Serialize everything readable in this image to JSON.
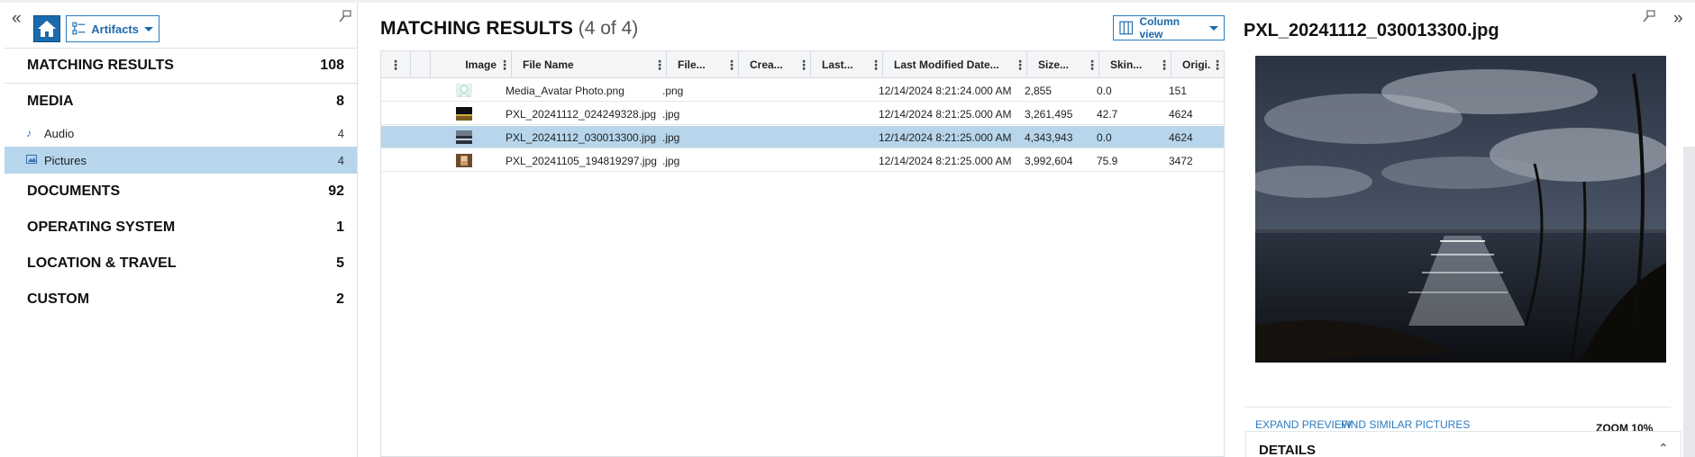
{
  "toolbar": {
    "artifacts_label": "Artifacts"
  },
  "categories": {
    "matching_results": {
      "label": "MATCHING RESULTS",
      "count": "108"
    },
    "media": {
      "label": "MEDIA",
      "count": "8"
    },
    "media_items": [
      {
        "label": "Audio",
        "count": "4",
        "icon": "music-note-icon"
      },
      {
        "label": "Pictures",
        "count": "4",
        "icon": "picture-icon",
        "selected": true
      }
    ],
    "documents": {
      "label": "DOCUMENTS",
      "count": "92"
    },
    "operating_system": {
      "label": "OPERATING SYSTEM",
      "count": "1"
    },
    "location_travel": {
      "label": "LOCATION & TRAVEL",
      "count": "5"
    },
    "custom": {
      "label": "CUSTOM",
      "count": "2"
    }
  },
  "main": {
    "title": "MATCHING RESULTS",
    "count": "(4 of 4)",
    "column_view_label": "Column view",
    "columns": [
      "Image",
      "File Name",
      "File...",
      "Crea...",
      "Last...",
      "Last Modified Date...",
      "Size...",
      "Skin...",
      "Origi..."
    ],
    "rows": [
      {
        "file_name": "Media_Avatar Photo.png",
        "ext": ".png",
        "created": "",
        "last": "",
        "modified": "12/14/2024 8:21:24.000 AM",
        "size": "2,855",
        "skin": "0.0",
        "orig": "151",
        "selected": false
      },
      {
        "file_name": "PXL_20241112_024249328.jpg",
        "ext": ".jpg",
        "created": "",
        "last": "",
        "modified": "12/14/2024 8:21:25.000 AM",
        "size": "3,261,495",
        "skin": "42.7",
        "orig": "4624",
        "selected": false
      },
      {
        "file_name": "PXL_20241112_030013300.jpg",
        "ext": ".jpg",
        "created": "",
        "last": "",
        "modified": "12/14/2024 8:21:25.000 AM",
        "size": "4,343,943",
        "skin": "0.0",
        "orig": "4624",
        "selected": true
      },
      {
        "file_name": "PXL_20241105_194819297.jpg",
        "ext": ".jpg",
        "created": "",
        "last": "",
        "modified": "12/14/2024 8:21:25.000 AM",
        "size": "3,992,604",
        "skin": "75.9",
        "orig": "3472",
        "selected": false
      }
    ]
  },
  "preview": {
    "title": "PXL_20241112_030013300.jpg",
    "expand_label": "EXPAND PREVIEW",
    "similar_label": "FIND SIMILAR PICTURES",
    "zoom_label": "ZOOM 10%",
    "details_label": "DETAILS"
  },
  "colors": {
    "accent": "#1b6aac",
    "selected_row": "#b7d6ec",
    "link": "#2b7bbf"
  }
}
